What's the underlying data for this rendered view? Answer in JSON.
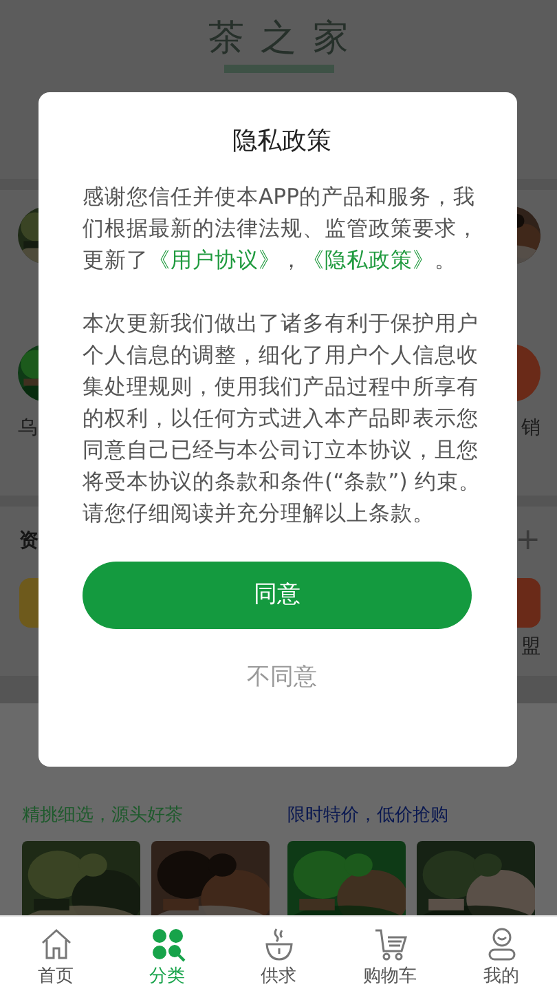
{
  "header": {
    "logo": "茶之家"
  },
  "categories": [
    [
      {
        "kind": "picture"
      },
      {
        "kind": "picture"
      }
    ],
    [
      {
        "kind": "picture",
        "label": "乌"
      },
      {
        "kind": "promo",
        "label": "销"
      }
    ]
  ],
  "section": {
    "title": "资",
    "action": "+"
  },
  "shortcuts": [
    {
      "color": "#6e5a1c"
    },
    {
      "color": "#6a2a18",
      "label": "盟"
    }
  ],
  "featured": [
    {
      "subtitle": "精挑细选，源头好茶",
      "color": "#1e5a2c",
      "images": [
        {
          "kind": "picture"
        },
        {
          "kind": "picture"
        }
      ]
    },
    {
      "subtitle": "限时特价，低价抢购",
      "color": "#0a1850",
      "images": [
        {
          "kind": "picture"
        },
        {
          "kind": "picture"
        }
      ]
    }
  ],
  "dialog": {
    "title": "隐私政策",
    "paragraphs": [
      [
        {
          "text": "感谢您信任并使本APP的产品和服务，我们根据最新的法律法规、监管政策要求，更新了",
          "kind": "text"
        },
        {
          "text": "《用户协议》",
          "kind": "link"
        },
        {
          "text": "，",
          "kind": "text"
        },
        {
          "text": "《隐私政策》",
          "kind": "link"
        },
        {
          "text": "。",
          "kind": "text"
        }
      ],
      [
        {
          "text": "本次更新我们做出了诸多有利于保护用户个人信息的调整，细化了用户个人信息收集处理规则，使用我们产品过程中所享有的权利，以任何方式进入本产品即表示您同意自己已经与本公司订立本协议，且您将受本协议的条款和条件(“条款”) 约束。请您仔细阅读并充分理解以上条款。",
          "kind": "text"
        }
      ]
    ],
    "agree": "同意",
    "disagree": "不同意"
  },
  "tabs": [
    {
      "label": "首页",
      "selected": false
    },
    {
      "label": "分类",
      "selected": true
    },
    {
      "label": "供求",
      "selected": false
    },
    {
      "label": "购物车",
      "selected": false
    },
    {
      "label": "我的",
      "selected": false
    }
  ]
}
